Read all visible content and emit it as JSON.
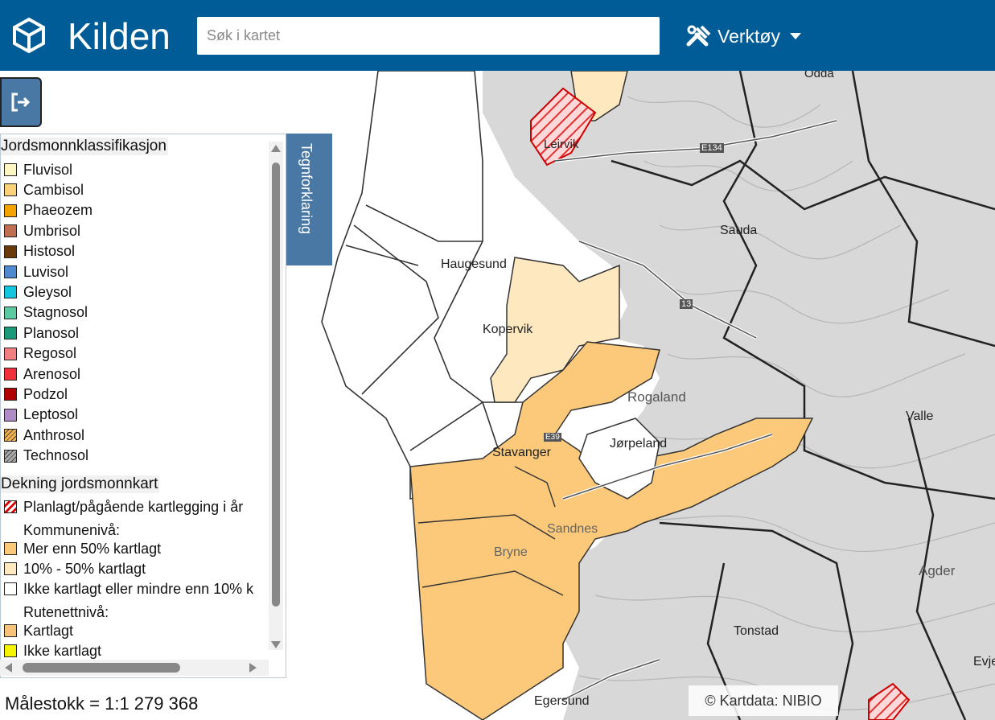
{
  "header": {
    "app_title": "Kilden",
    "search_placeholder": "Søk i kartet",
    "tools_label": "Verktøy"
  },
  "legend": {
    "tab_label": "Tegnforklaring",
    "classification_title": "Jordsmonnklassifikasjon",
    "classes": [
      {
        "label": "Fluvisol",
        "color": "#fdf6c3"
      },
      {
        "label": "Cambisol",
        "color": "#fbd17a"
      },
      {
        "label": "Phaeozem",
        "color": "#f5a300"
      },
      {
        "label": "Umbrisol",
        "color": "#c07050"
      },
      {
        "label": "Histosol",
        "color": "#6b3a0a"
      },
      {
        "label": "Luvisol",
        "color": "#4f8ad0"
      },
      {
        "label": "Gleysol",
        "color": "#12c6e0"
      },
      {
        "label": "Stagnosol",
        "color": "#5cc9a0"
      },
      {
        "label": "Planosol",
        "color": "#1a9a78"
      },
      {
        "label": "Regosol",
        "color": "#f27f80"
      },
      {
        "label": "Arenosol",
        "color": "#f2303b"
      },
      {
        "label": "Podzol",
        "color": "#b00000"
      },
      {
        "label": "Leptosol",
        "color": "#b08cc6"
      },
      {
        "label": "Anthrosol",
        "color": "#f6b24a"
      },
      {
        "label": "Technosol",
        "color": "#a0a0a0"
      }
    ],
    "coverage_title": "Dekning jordsmonnkart",
    "planned_label": "Planlagt/pågående kartlegging i år",
    "municipality_label": "Kommunenivå:",
    "municipality_items": [
      {
        "label": "Mer enn 50% kartlagt",
        "color": "#fcc97a"
      },
      {
        "label": "10% - 50% kartlagt",
        "color": "#fde8c0"
      },
      {
        "label": "Ikke kartlagt eller mindre enn 10% k",
        "color": "#ffffff"
      }
    ],
    "grid_label": "Rutenettnivå:",
    "grid_items": [
      {
        "label": "Kartlagt",
        "color": "#f8c27a"
      },
      {
        "label": "Ikke kartlagt",
        "color": "#f5f500"
      }
    ]
  },
  "map": {
    "places": [
      "Odda",
      "Leirvik",
      "E134",
      "Sauda",
      "Haugesund",
      "13",
      "Kopervik",
      "Rogaland",
      "Valle",
      "Jørpeland",
      "Stavanger",
      "Sandnes",
      "Bryne",
      "Agder",
      "Tonstad",
      "Egersund",
      "Evje",
      "E39"
    ],
    "scale": "Målestokk = 1:1 279 368",
    "attribution": "© Kartdata:  NIBIO"
  }
}
